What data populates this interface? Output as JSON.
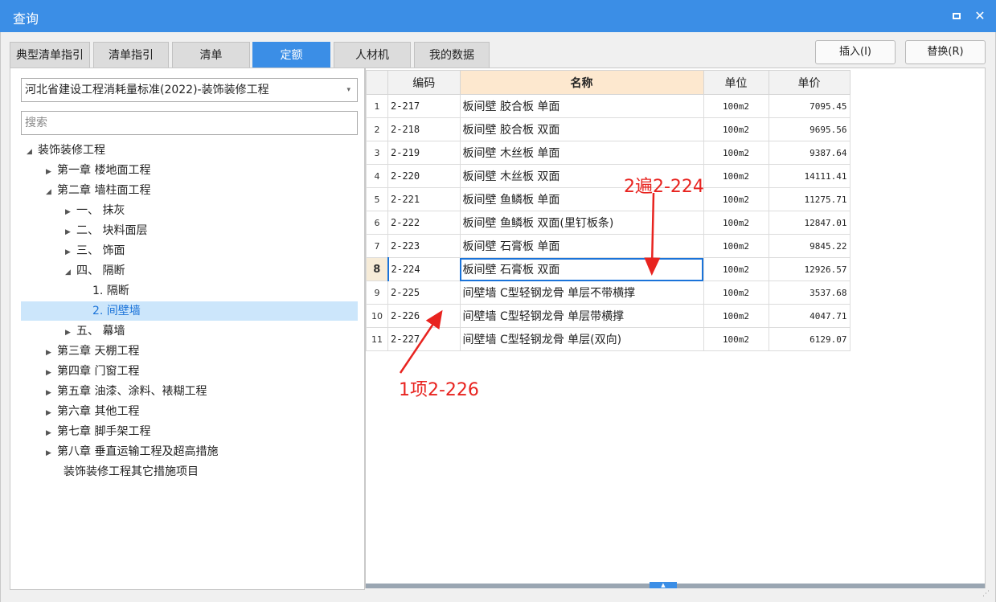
{
  "window": {
    "title": "查询",
    "maximize_glyph": "□",
    "close_glyph": "✕"
  },
  "tabs": [
    {
      "label": "典型清单指引"
    },
    {
      "label": "清单指引"
    },
    {
      "label": "清单"
    },
    {
      "label": "定额",
      "active": true
    },
    {
      "label": "人材机"
    },
    {
      "label": "我的数据"
    }
  ],
  "toolbar": {
    "insert_label": "插入(I)",
    "replace_label": "替换(R)"
  },
  "left": {
    "library_value": "河北省建设工程消耗量标准(2022)-装饰装修工程",
    "search_placeholder": "搜索"
  },
  "tree": [
    {
      "label": "装饰装修工程",
      "toggle": "◢"
    },
    {
      "label": "第一章 楼地面工程",
      "toggle": "▶"
    },
    {
      "label": "第二章 墙柱面工程",
      "toggle": "◢"
    },
    {
      "label": "一、 抹灰",
      "toggle": "▶"
    },
    {
      "label": "二、 块料面层",
      "toggle": "▶"
    },
    {
      "label": "三、 饰面",
      "toggle": "▶"
    },
    {
      "label": "四、 隔断",
      "toggle": "◢"
    },
    {
      "label": "1. 隔断",
      "toggle": ""
    },
    {
      "label": "2. 间壁墙",
      "toggle": "",
      "selected": true
    },
    {
      "label": "五、 幕墙",
      "toggle": "▶"
    },
    {
      "label": "第三章 天棚工程",
      "toggle": "▶"
    },
    {
      "label": "第四章 门窗工程",
      "toggle": "▶"
    },
    {
      "label": "第五章 油漆、涂料、裱糊工程",
      "toggle": "▶"
    },
    {
      "label": "第六章 其他工程",
      "toggle": "▶"
    },
    {
      "label": "第七章 脚手架工程",
      "toggle": "▶"
    },
    {
      "label": "第八章 垂直运输工程及超高措施",
      "toggle": "▶"
    },
    {
      "label": "装饰装修工程其它措施项目",
      "toggle": ""
    }
  ],
  "grid": {
    "columns": [
      "编码",
      "名称",
      "单位",
      "单价"
    ],
    "rows": [
      {
        "n": "1",
        "code": "2-217",
        "name": "板间壁 胶合板 单面",
        "unit": "100m2",
        "price": "7095.45"
      },
      {
        "n": "2",
        "code": "2-218",
        "name": "板间壁 胶合板 双面",
        "unit": "100m2",
        "price": "9695.56"
      },
      {
        "n": "3",
        "code": "2-219",
        "name": "板间壁 木丝板 单面",
        "unit": "100m2",
        "price": "9387.64"
      },
      {
        "n": "4",
        "code": "2-220",
        "name": "板间壁 木丝板 双面",
        "unit": "100m2",
        "price": "14111.41"
      },
      {
        "n": "5",
        "code": "2-221",
        "name": "板间壁 鱼鳞板 单面",
        "unit": "100m2",
        "price": "11275.71"
      },
      {
        "n": "6",
        "code": "2-222",
        "name": "板间壁 鱼鳞板 双面(里钉板条)",
        "unit": "100m2",
        "price": "12847.01"
      },
      {
        "n": "7",
        "code": "2-223",
        "name": "板间壁 石膏板 单面",
        "unit": "100m2",
        "price": "9845.22"
      },
      {
        "n": "8",
        "code": "2-224",
        "name": "板间壁 石膏板 双面",
        "unit": "100m2",
        "price": "12926.57",
        "current": true
      },
      {
        "n": "9",
        "code": "2-225",
        "name": "间壁墙 C型轻钢龙骨 单层不带横撑",
        "unit": "100m2",
        "price": "3537.68"
      },
      {
        "n": "10",
        "code": "2-226",
        "name": "间壁墙 C型轻钢龙骨 单层带横撑",
        "unit": "100m2",
        "price": "4047.71"
      },
      {
        "n": "11",
        "code": "2-227",
        "name": "间壁墙 C型轻钢龙骨 单层(双向)",
        "unit": "100m2",
        "price": "6129.07"
      }
    ]
  },
  "annotations": {
    "a1": "1项2-226",
    "a2": "2遍2-224",
    "color": "#e8231f"
  },
  "colors": {
    "accent": "#3b8ee6",
    "selection": "#cce6fb",
    "header_highlight": "#fde8cf"
  }
}
